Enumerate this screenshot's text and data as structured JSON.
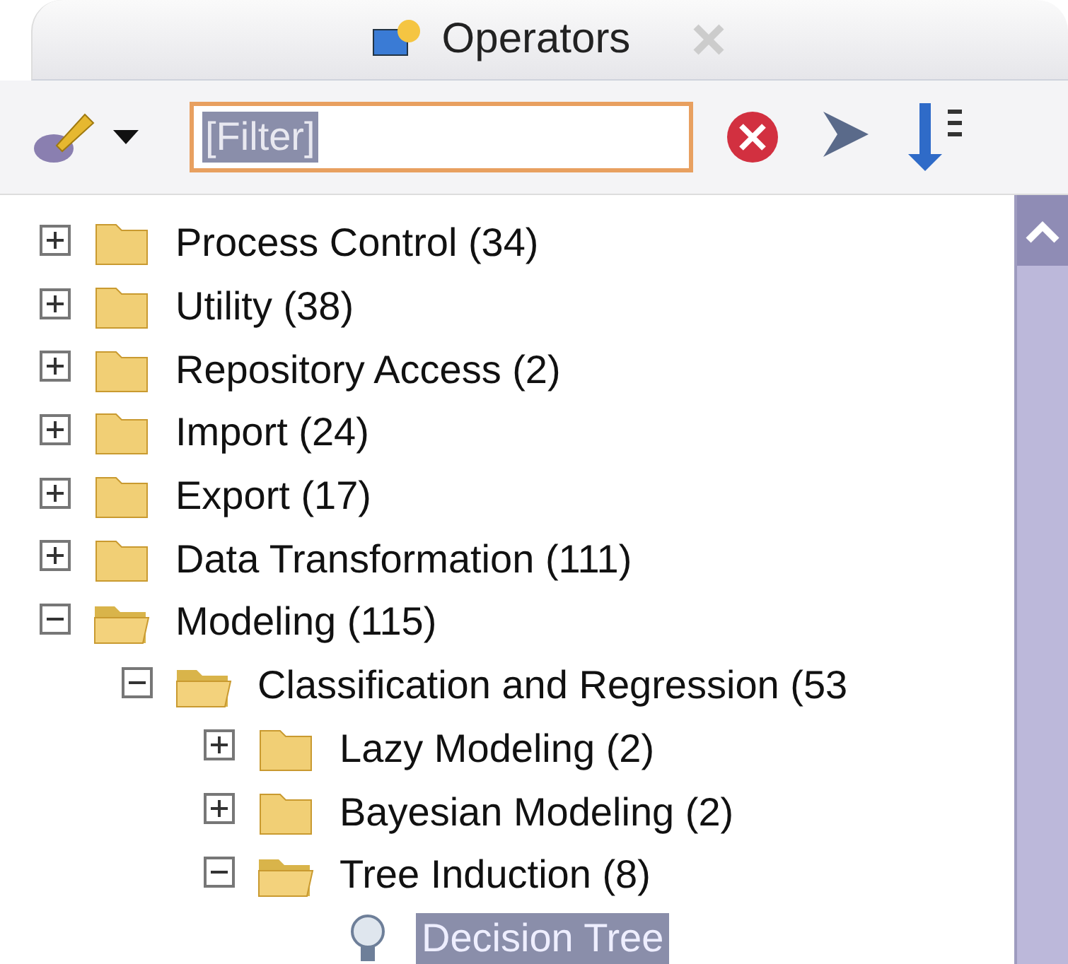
{
  "panel": {
    "title": "Operators"
  },
  "toolbar": {
    "filter": {
      "value": "[Filter]",
      "selected": true
    }
  },
  "tree": [
    {
      "kind": "folder",
      "label": "Process Control (34)",
      "expanded": false
    },
    {
      "kind": "folder",
      "label": "Utility (38)",
      "expanded": false
    },
    {
      "kind": "folder",
      "label": "Repository Access (2)",
      "expanded": false
    },
    {
      "kind": "folder",
      "label": "Import (24)",
      "expanded": false
    },
    {
      "kind": "folder",
      "label": "Export (17)",
      "expanded": false
    },
    {
      "kind": "folder",
      "label": "Data Transformation (111)",
      "expanded": false
    },
    {
      "kind": "folder",
      "label": "Modeling (115)",
      "expanded": true,
      "children": [
        {
          "kind": "folder",
          "label": "Classification and Regression (53",
          "expanded": true,
          "children": [
            {
              "kind": "folder",
              "label": "Lazy Modeling (2)",
              "expanded": false
            },
            {
              "kind": "folder",
              "label": "Bayesian Modeling (2)",
              "expanded": false
            },
            {
              "kind": "folder",
              "label": "Tree Induction (8)",
              "expanded": true,
              "children": [
                {
                  "kind": "operator",
                  "label": "Decision Tree",
                  "selected": true
                }
              ]
            }
          ]
        }
      ]
    }
  ]
}
